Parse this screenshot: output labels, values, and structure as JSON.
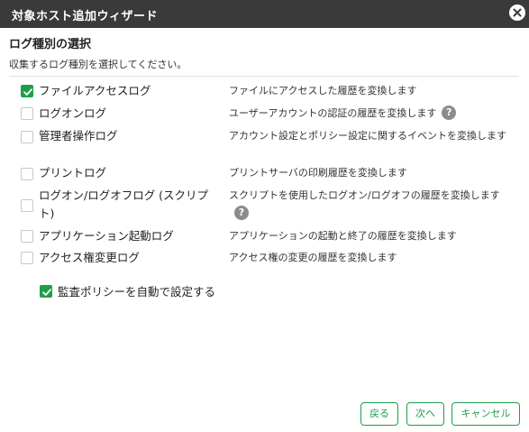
{
  "window": {
    "title": "対象ホスト追加ウィザード",
    "close_icon": "close-icon"
  },
  "section": {
    "heading": "ログ種別の選択",
    "description": "収集するログ種別を選択してください。"
  },
  "log_types": [
    {
      "name": "ファイルアクセスログ",
      "description": "ファイルにアクセスした履歴を変換します",
      "checked": true,
      "help": false
    },
    {
      "name": "ログオンログ",
      "description": "ユーザーアカウントの認証の履歴を変換します",
      "checked": false,
      "help": true
    },
    {
      "name": "管理者操作ログ",
      "description": "アカウント設定とポリシー設定に関するイベントを変換します",
      "checked": false,
      "help": false
    },
    {
      "name": "プリントログ",
      "description": "プリントサーバの印刷履歴を変換します",
      "checked": false,
      "help": false
    },
    {
      "name": "ログオン/ログオフログ (スクリプト)",
      "description": "スクリプトを使用したログオン/ログオフの履歴を変換します",
      "checked": false,
      "help": true
    },
    {
      "name": "アプリケーション起動ログ",
      "description": "アプリケーションの起動と終了の履歴を変換します",
      "checked": false,
      "help": false
    },
    {
      "name": "アクセス権変更ログ",
      "description": "アクセス権の変更の履歴を変換します",
      "checked": false,
      "help": false
    }
  ],
  "auto_policy": {
    "label": "監査ポリシーを自動で設定する",
    "checked": true
  },
  "help_glyph": "?",
  "buttons": {
    "back": "戻る",
    "next": "次へ",
    "cancel": "キャンセル"
  },
  "colors": {
    "accent": "#1e9e4a",
    "titlebar": "#3a3a3a",
    "help_icon": "#8c8c8c"
  }
}
